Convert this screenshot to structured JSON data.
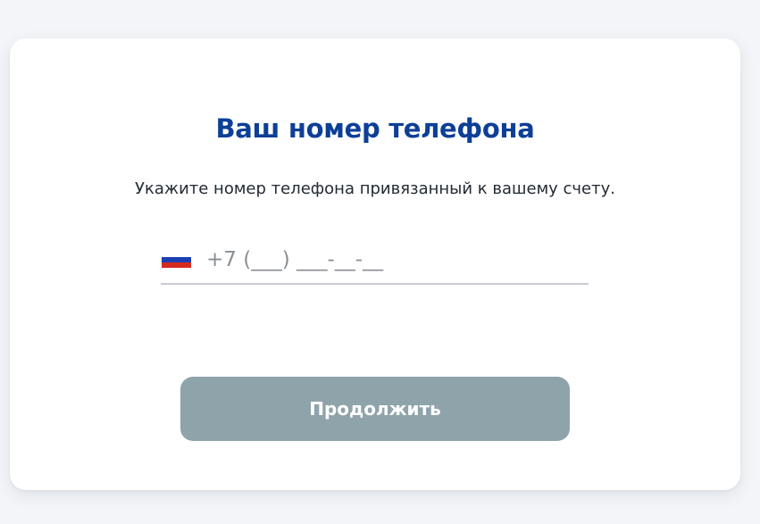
{
  "card": {
    "title": "Ваш номер телефона",
    "subtitle": "Укажите номер телефона привязанный к вашему счету."
  },
  "phone": {
    "country_icon": "russia-flag-icon",
    "placeholder": "+7 (___) ___-__-__",
    "value": ""
  },
  "actions": {
    "continue_label": "Продолжить"
  },
  "colors": {
    "title": "#0d3f97",
    "button_disabled": "#8fa3aa",
    "background": "#f3f5f8"
  }
}
